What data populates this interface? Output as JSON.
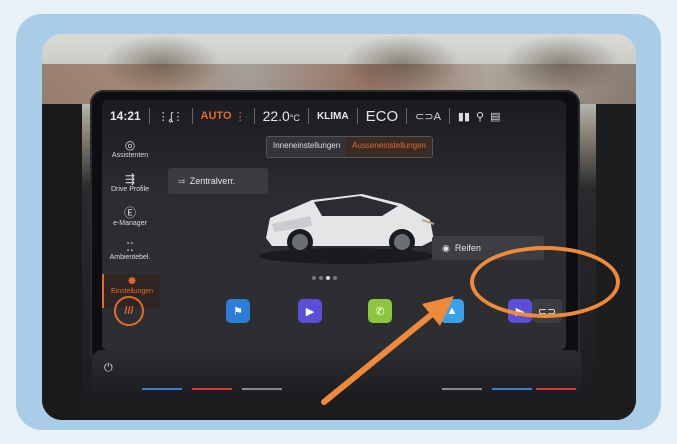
{
  "status": {
    "time": "14:21",
    "auto": "AUTO",
    "temperature": "22.0",
    "temp_unit": "°C",
    "klima": "KLIMA",
    "eco": "ECO",
    "car_mode": "A"
  },
  "sidebar": {
    "items": [
      {
        "label": "Assistenten",
        "icon": "steering-wheel-icon"
      },
      {
        "label": "Drive Profile",
        "icon": "drive-profile-icon"
      },
      {
        "label": "e-Manager",
        "icon": "e-manager-icon"
      },
      {
        "label": "Ambientebel.",
        "icon": "ambient-light-icon"
      },
      {
        "label": "Einstellungen",
        "icon": "gear-icon"
      }
    ]
  },
  "tabs": [
    "Inneneinstellungen",
    "Ausseneinstellungen"
  ],
  "buttons": {
    "zentral": "Zentralverr.",
    "reifen": "Reifen"
  },
  "menu_button": "///",
  "colors": {
    "accent": "#e6682b",
    "annotation": "#ef8a3a",
    "frame": "#a9cde6"
  }
}
